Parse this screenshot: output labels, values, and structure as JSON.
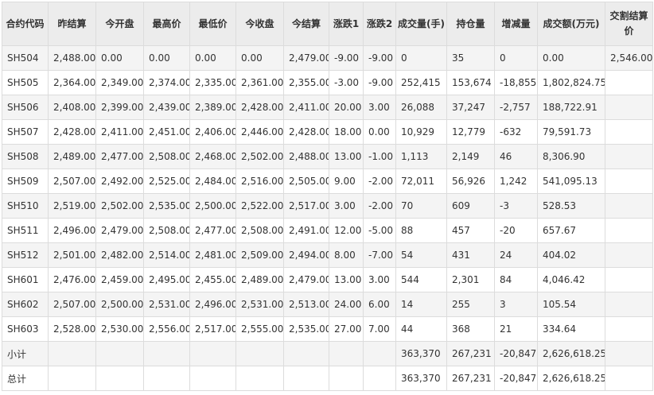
{
  "table": {
    "headers": [
      "合约代码",
      "昨结算",
      "今开盘",
      "最高价",
      "最低价",
      "今收盘",
      "今结算",
      "涨跌1",
      "涨跌2",
      "成交量(手)",
      "持仓量",
      "增减量",
      "成交额(万元)",
      "交割结算价"
    ],
    "rows": [
      [
        "SH504",
        "2,488.00",
        "0.00",
        "0.00",
        "0.00",
        "0.00",
        "2,479.00",
        "-9.00",
        "-9.00",
        "0",
        "35",
        "0",
        "0.00",
        "2,546.00"
      ],
      [
        "SH505",
        "2,364.00",
        "2,349.00",
        "2,374.00",
        "2,335.00",
        "2,361.00",
        "2,355.00",
        "-3.00",
        "-9.00",
        "252,415",
        "153,674",
        "-18,855",
        "1,802,824.75",
        ""
      ],
      [
        "SH506",
        "2,408.00",
        "2,399.00",
        "2,439.00",
        "2,389.00",
        "2,428.00",
        "2,411.00",
        "20.00",
        "3.00",
        "26,088",
        "37,247",
        "-2,757",
        "188,722.91",
        ""
      ],
      [
        "SH507",
        "2,428.00",
        "2,411.00",
        "2,451.00",
        "2,406.00",
        "2,446.00",
        "2,428.00",
        "18.00",
        "0.00",
        "10,929",
        "12,779",
        "-632",
        "79,591.73",
        ""
      ],
      [
        "SH508",
        "2,489.00",
        "2,477.00",
        "2,508.00",
        "2,468.00",
        "2,502.00",
        "2,488.00",
        "13.00",
        "-1.00",
        "1,113",
        "2,149",
        "46",
        "8,306.90",
        ""
      ],
      [
        "SH509",
        "2,507.00",
        "2,492.00",
        "2,525.00",
        "2,484.00",
        "2,516.00",
        "2,505.00",
        "9.00",
        "-2.00",
        "72,011",
        "56,926",
        "1,242",
        "541,095.13",
        ""
      ],
      [
        "SH510",
        "2,519.00",
        "2,502.00",
        "2,535.00",
        "2,500.00",
        "2,522.00",
        "2,517.00",
        "3.00",
        "-2.00",
        "70",
        "609",
        "-3",
        "528.53",
        ""
      ],
      [
        "SH511",
        "2,496.00",
        "2,479.00",
        "2,508.00",
        "2,477.00",
        "2,508.00",
        "2,491.00",
        "12.00",
        "-5.00",
        "88",
        "457",
        "-20",
        "657.67",
        ""
      ],
      [
        "SH512",
        "2,501.00",
        "2,482.00",
        "2,514.00",
        "2,481.00",
        "2,509.00",
        "2,494.00",
        "8.00",
        "-7.00",
        "54",
        "431",
        "24",
        "404.02",
        ""
      ],
      [
        "SH601",
        "2,476.00",
        "2,459.00",
        "2,495.00",
        "2,455.00",
        "2,489.00",
        "2,479.00",
        "13.00",
        "3.00",
        "544",
        "2,301",
        "84",
        "4,046.42",
        ""
      ],
      [
        "SH602",
        "2,507.00",
        "2,500.00",
        "2,531.00",
        "2,496.00",
        "2,531.00",
        "2,513.00",
        "24.00",
        "6.00",
        "14",
        "255",
        "3",
        "105.54",
        ""
      ],
      [
        "SH603",
        "2,528.00",
        "2,530.00",
        "2,556.00",
        "2,517.00",
        "2,555.00",
        "2,535.00",
        "27.00",
        "7.00",
        "44",
        "368",
        "21",
        "334.64",
        ""
      ],
      [
        "小计",
        "",
        "",
        "",
        "",
        "",
        "",
        "",
        "",
        "363,370",
        "267,231",
        "-20,847",
        "2,626,618.25",
        ""
      ],
      [
        "总计",
        "",
        "",
        "",
        "",
        "",
        "",
        "",
        "",
        "363,370",
        "267,231",
        "-20,847",
        "2,626,618.25",
        ""
      ]
    ]
  }
}
